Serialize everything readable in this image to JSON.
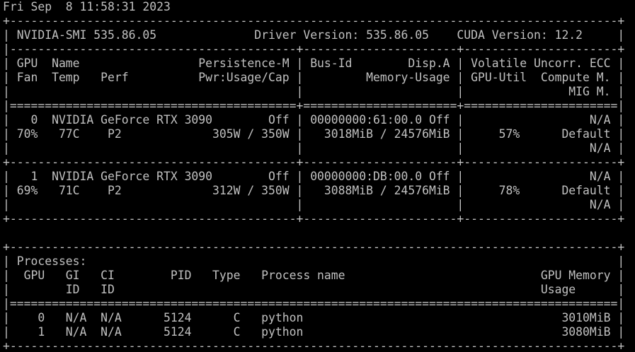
{
  "colors": {
    "background": "#000000",
    "foreground": "#c0c0c0"
  },
  "terminal": {
    "lines": [
      "Fri Sep  8 11:58:31 2023",
      "+---------------------------------------------------------------------------------------+",
      "| NVIDIA-SMI 535.86.05              Driver Version: 535.86.05    CUDA Version: 12.2     |",
      "|-----------------------------------------+----------------------+----------------------+",
      "| GPU  Name                 Persistence-M | Bus-Id        Disp.A | Volatile Uncorr. ECC |",
      "| Fan  Temp   Perf          Pwr:Usage/Cap |         Memory-Usage | GPU-Util  Compute M. |",
      "|                                         |                      |               MIG M. |",
      "|=========================================+======================+======================|",
      "|   0  NVIDIA GeForce RTX 3090        Off | 00000000:61:00.0 Off |                  N/A |",
      "| 70%   77C    P2             305W / 350W |   3018MiB / 24576MiB |     57%      Default |",
      "|                                         |                      |                  N/A |",
      "+-----------------------------------------+----------------------+----------------------+",
      "|   1  NVIDIA GeForce RTX 3090        Off | 00000000:DB:00.0 Off |                  N/A |",
      "| 69%   71C    P2             312W / 350W |   3088MiB / 24576MiB |     78%      Default |",
      "|                                         |                      |                  N/A |",
      "+-----------------------------------------+----------------------+----------------------+",
      "",
      "+---------------------------------------------------------------------------------------+",
      "| Processes:                                                                            |",
      "|  GPU   GI   CI        PID   Type   Process name                            GPU Memory |",
      "|        ID   ID                                                             Usage      |",
      "|=======================================================================================|",
      "|    0   N/A  N/A      5124      C   python                                     3010MiB |",
      "|    1   N/A  N/A      5124      C   python                                     3080MiB |",
      "+---------------------------------------------------------------------------------------+"
    ]
  }
}
